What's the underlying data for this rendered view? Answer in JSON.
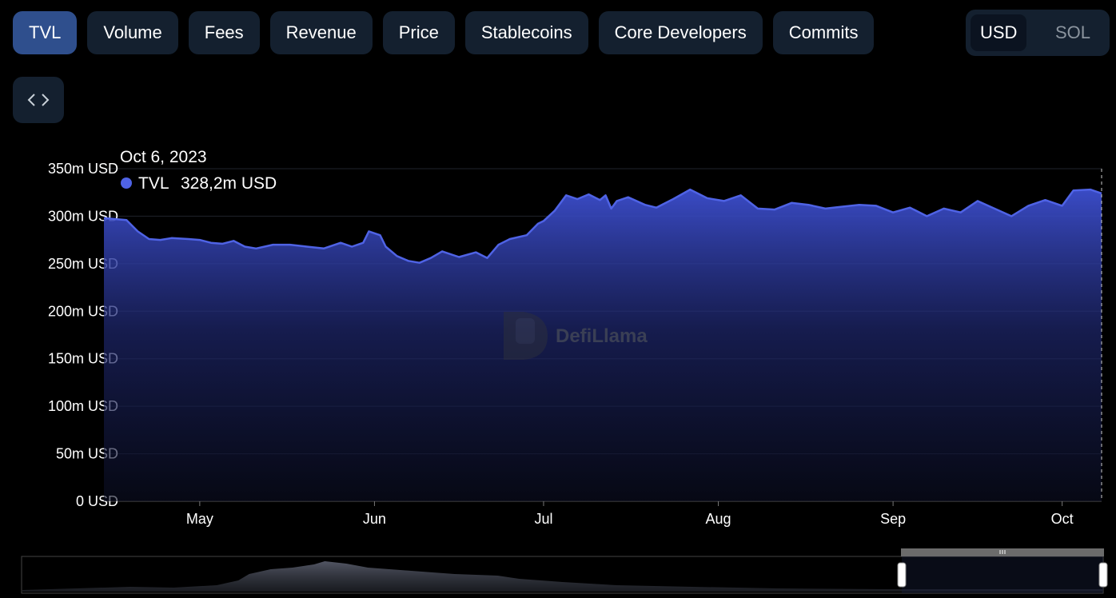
{
  "tabs": [
    {
      "label": "TVL",
      "active": true
    },
    {
      "label": "Volume",
      "active": false
    },
    {
      "label": "Fees",
      "active": false
    },
    {
      "label": "Revenue",
      "active": false
    },
    {
      "label": "Price",
      "active": false
    },
    {
      "label": "Stablecoins",
      "active": false
    },
    {
      "label": "Core Developers",
      "active": false
    },
    {
      "label": "Commits",
      "active": false
    }
  ],
  "currency": {
    "usd": "USD",
    "sol": "SOL",
    "selected": "USD"
  },
  "embed_icon": "code-brackets-icon",
  "watermark": "DefiLlama",
  "tooltip": {
    "date": "Oct 6, 2023",
    "series": "TVL",
    "value": "328,2m USD"
  },
  "colors": {
    "accent": "#4f63e5",
    "tab_active": "#2f4f8d",
    "tab_bg": "#14202f",
    "background": "#000000"
  },
  "chart_data": {
    "type": "area",
    "ylim": [
      0,
      350
    ],
    "ytick_values": [
      0,
      50,
      100,
      150,
      200,
      250,
      300,
      350
    ],
    "ytick_labels": [
      "0 USD",
      "50m USD",
      "100m USD",
      "150m USD",
      "200m USD",
      "250m USD",
      "300m USD",
      "350m USD"
    ],
    "x_start": "2023-04-14",
    "x_end": "2023-10-08",
    "xtick_dates": [
      "2023-05-01",
      "2023-06-01",
      "2023-07-01",
      "2023-08-01",
      "2023-09-01",
      "2023-10-01"
    ],
    "xtick_labels": [
      "May",
      "Jun",
      "Jul",
      "Aug",
      "Sep",
      "Oct"
    ],
    "grid": true,
    "series": [
      {
        "name": "TVL",
        "x": [
          "2023-04-14",
          "2023-04-16",
          "2023-04-18",
          "2023-04-20",
          "2023-04-22",
          "2023-04-24",
          "2023-04-26",
          "2023-04-29",
          "2023-05-01",
          "2023-05-03",
          "2023-05-05",
          "2023-05-07",
          "2023-05-09",
          "2023-05-11",
          "2023-05-14",
          "2023-05-17",
          "2023-05-20",
          "2023-05-23",
          "2023-05-26",
          "2023-05-28",
          "2023-05-30",
          "2023-05-31",
          "2023-06-02",
          "2023-06-03",
          "2023-06-05",
          "2023-06-07",
          "2023-06-09",
          "2023-06-11",
          "2023-06-13",
          "2023-06-16",
          "2023-06-19",
          "2023-06-21",
          "2023-06-23",
          "2023-06-25",
          "2023-06-28",
          "2023-06-30",
          "2023-07-01",
          "2023-07-03",
          "2023-07-05",
          "2023-07-07",
          "2023-07-09",
          "2023-07-11",
          "2023-07-12",
          "2023-07-13",
          "2023-07-14",
          "2023-07-16",
          "2023-07-19",
          "2023-07-21",
          "2023-07-24",
          "2023-07-27",
          "2023-07-30",
          "2023-08-02",
          "2023-08-05",
          "2023-08-08",
          "2023-08-11",
          "2023-08-14",
          "2023-08-17",
          "2023-08-20",
          "2023-08-23",
          "2023-08-26",
          "2023-08-29",
          "2023-09-01",
          "2023-09-04",
          "2023-09-07",
          "2023-09-10",
          "2023-09-13",
          "2023-09-16",
          "2023-09-19",
          "2023-09-22",
          "2023-09-25",
          "2023-09-28",
          "2023-10-01",
          "2023-10-03",
          "2023-10-06",
          "2023-10-08"
        ],
        "values": [
          298,
          297,
          296,
          284,
          276,
          275,
          277,
          276,
          275,
          272,
          271,
          274,
          268,
          266,
          270,
          270,
          268,
          266,
          272,
          268,
          272,
          284,
          280,
          268,
          258,
          253,
          251,
          256,
          263,
          257,
          262,
          256,
          270,
          276,
          280,
          292,
          295,
          306,
          322,
          318,
          323,
          317,
          322,
          308,
          316,
          320,
          312,
          309,
          318,
          328,
          319,
          316,
          322,
          308,
          307,
          314,
          312,
          308,
          310,
          312,
          311,
          304,
          309,
          300,
          308,
          304,
          316,
          308,
          300,
          311,
          317,
          311,
          327,
          328,
          324
        ]
      }
    ]
  }
}
